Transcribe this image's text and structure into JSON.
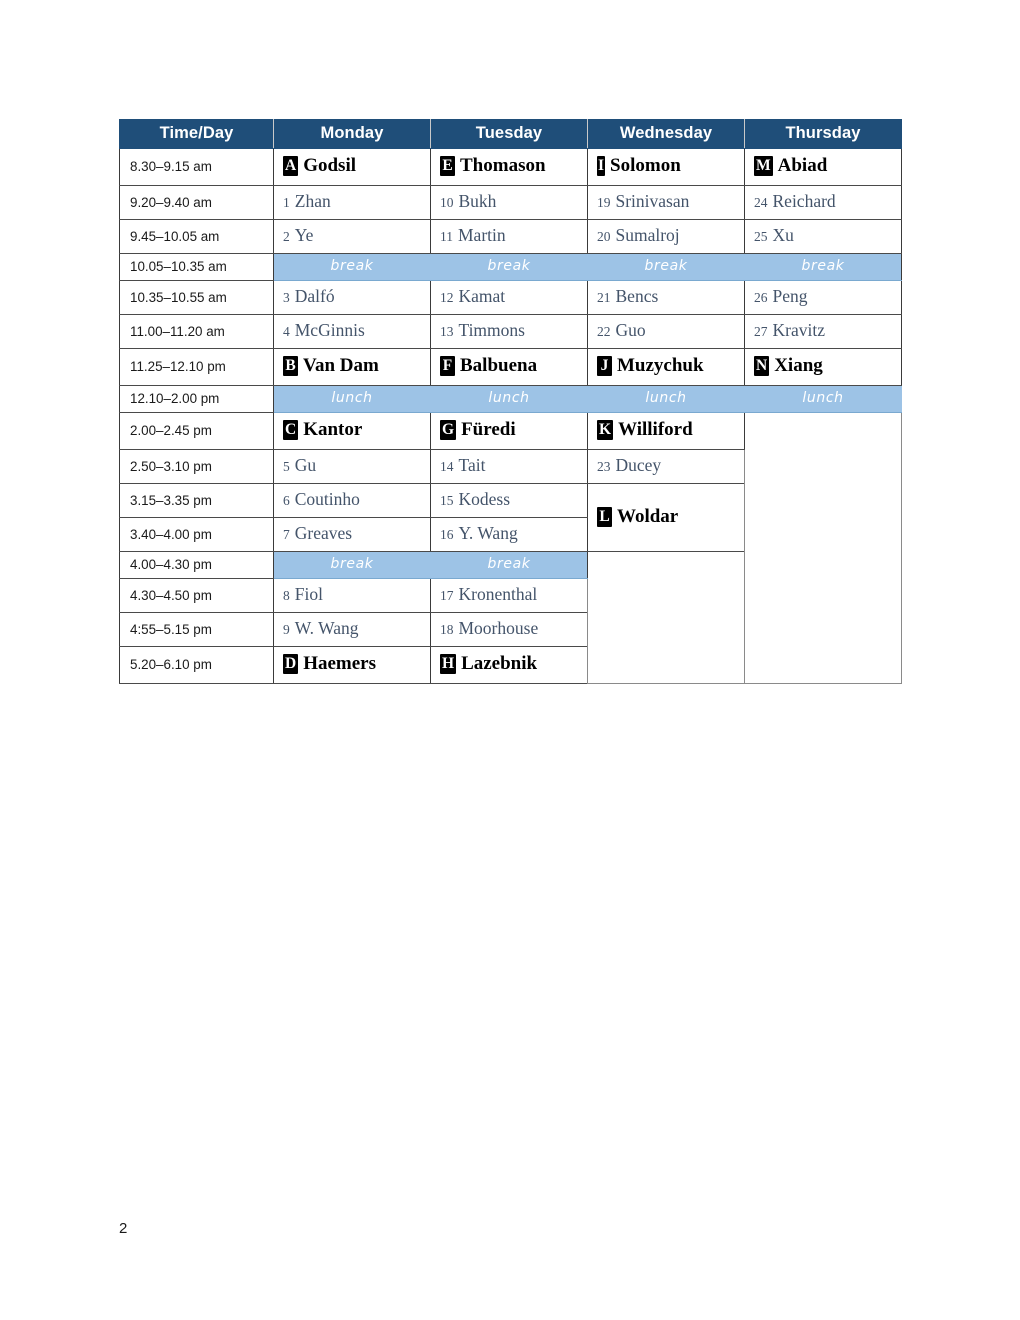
{
  "page": {
    "page_number": "2"
  },
  "table": {
    "headers": [
      "Time/Day",
      "Monday",
      "Tuesday",
      "Wednesday",
      "Thursday"
    ],
    "band_labels": {
      "break": "break",
      "lunch": "lunch"
    },
    "rows": [
      {
        "time": "8.30–9.15 am",
        "kind": "plenary",
        "cells": [
          {
            "badge": "A",
            "name": "Godsil"
          },
          {
            "badge": "E",
            "name": "Thomason"
          },
          {
            "badge": "I",
            "name": "Solomon"
          },
          {
            "badge": "M",
            "name": "Abiad"
          }
        ]
      },
      {
        "time": "9.20–9.40 am",
        "kind": "session",
        "cells": [
          {
            "num": "1",
            "name": "Zhan"
          },
          {
            "num": "10",
            "name": "Bukh"
          },
          {
            "num": "19",
            "name": "Srinivasan"
          },
          {
            "num": "24",
            "name": "Reichard"
          }
        ]
      },
      {
        "time": "9.45–10.05 am",
        "kind": "session",
        "cells": [
          {
            "num": "2",
            "name": "Ye"
          },
          {
            "num": "11",
            "name": "Martin"
          },
          {
            "num": "20",
            "name": "Sumalroj"
          },
          {
            "num": "25",
            "name": "Xu"
          }
        ]
      },
      {
        "time": "10.05–10.35 am",
        "kind": "break",
        "cells": [
          {
            "label": "break"
          },
          {
            "label": "break"
          },
          {
            "label": "break"
          },
          {
            "label": "break"
          }
        ]
      },
      {
        "time": "10.35–10.55 am",
        "kind": "session",
        "cells": [
          {
            "num": "3",
            "name": "Dalfó"
          },
          {
            "num": "12",
            "name": "Kamat"
          },
          {
            "num": "21",
            "name": "Bencs"
          },
          {
            "num": "26",
            "name": "Peng"
          }
        ]
      },
      {
        "time": "11.00–11.20 am",
        "kind": "session",
        "cells": [
          {
            "num": "4",
            "name": "McGinnis"
          },
          {
            "num": "13",
            "name": "Timmons"
          },
          {
            "num": "22",
            "name": "Guo"
          },
          {
            "num": "27",
            "name": "Kravitz"
          }
        ]
      },
      {
        "time": "11.25–12.10 pm",
        "kind": "plenary",
        "cells": [
          {
            "badge": "B",
            "name": "Van Dam"
          },
          {
            "badge": "F",
            "name": "Balbuena"
          },
          {
            "badge": "J",
            "name": "Muzychuk"
          },
          {
            "badge": "N",
            "name": "Xiang"
          }
        ]
      },
      {
        "time": "12.10–2.00 pm",
        "kind": "lunch",
        "cells": [
          {
            "label": "lunch"
          },
          {
            "label": "lunch"
          },
          {
            "label": "lunch"
          },
          {
            "label": "lunch"
          }
        ]
      },
      {
        "time": "2.00–2.45 pm",
        "kind": "plenary",
        "cells": [
          {
            "badge": "C",
            "name": "Kantor"
          },
          {
            "badge": "G",
            "name": "Füredi"
          },
          {
            "badge": "K",
            "name": "Williford"
          },
          {
            "empty": true
          }
        ]
      },
      {
        "time": "2.50–3.10 pm",
        "kind": "session",
        "cells": [
          {
            "num": "5",
            "name": "Gu"
          },
          {
            "num": "14",
            "name": "Tait"
          },
          {
            "num": "23",
            "name": "Ducey"
          }
        ]
      },
      {
        "time": "3.15–3.35 pm",
        "kind": "session",
        "cells": [
          {
            "num": "6",
            "name": "Coutinho"
          },
          {
            "num": "15",
            "name": "Kodess"
          },
          {
            "badge": "L",
            "name": "Woldar"
          }
        ]
      },
      {
        "time": "3.40–4.00 pm",
        "kind": "session",
        "cells": [
          {
            "num": "7",
            "name": "Greaves"
          },
          {
            "num": "16",
            "name": "Y. Wang"
          }
        ]
      },
      {
        "time": "4.00–4.30 pm",
        "kind": "break",
        "cells": [
          {
            "label": "break"
          },
          {
            "label": "break"
          }
        ]
      },
      {
        "time": "4.30–4.50 pm",
        "kind": "session",
        "cells": [
          {
            "num": "8",
            "name": "Fiol"
          },
          {
            "num": "17",
            "name": "Kronenthal"
          }
        ]
      },
      {
        "time": "4:55–5.15 pm",
        "kind": "session",
        "cells": [
          {
            "num": "9",
            "name": "W. Wang"
          },
          {
            "num": "18",
            "name": "Moorhouse"
          }
        ]
      },
      {
        "time": "5.20–6.10 pm",
        "kind": "plenary",
        "cells": [
          {
            "badge": "D",
            "name": "Haemers"
          },
          {
            "badge": "H",
            "name": "Lazebnik"
          }
        ]
      }
    ]
  },
  "colors": {
    "header_bg": "#1F4E79",
    "band_bg": "#9DC3E6",
    "session_text": "#44546A",
    "plenary_text": "#000000",
    "time_text": "#1A1A1A"
  }
}
